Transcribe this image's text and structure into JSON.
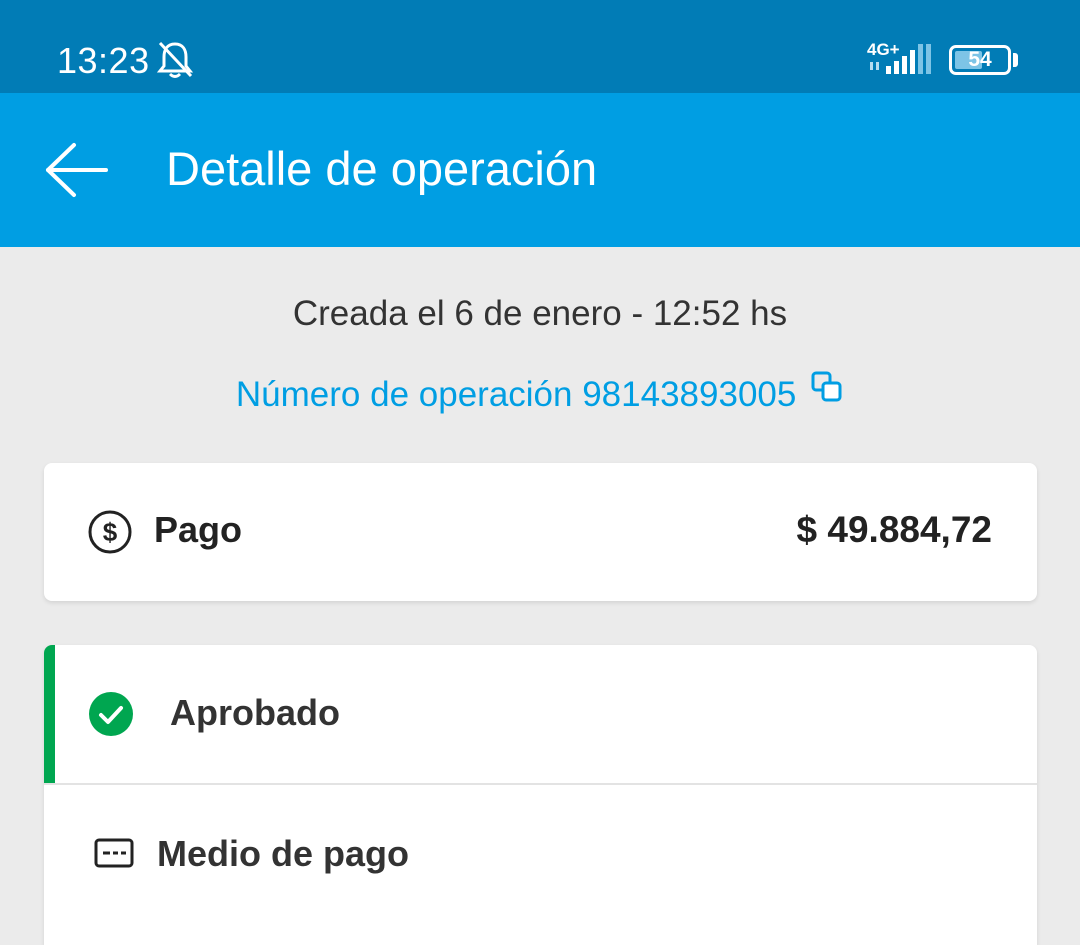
{
  "status_bar": {
    "time": "13:23",
    "network": "4G+",
    "battery": "54",
    "battery_level": 0.54,
    "icons": [
      "bell-off-icon",
      "signal-icon",
      "battery-icon"
    ]
  },
  "app_bar": {
    "back_icon": "arrow-left-icon",
    "title": "Detalle de operación"
  },
  "summary": {
    "created": "Creada el 6 de enero - 12:52 hs",
    "operation_number": "Número de operación 98143893005",
    "copy_icon": "copy-icon"
  },
  "payment": {
    "icon": "dollar-circle-icon",
    "label": "Pago",
    "amount": "$ 49.884,72"
  },
  "status": {
    "icon": "check-circle-icon",
    "label": "Aprobado",
    "color": "#00a650"
  },
  "payment_method": {
    "icon": "credit-card-icon",
    "label": "Medio de pago"
  },
  "colors": {
    "status_bar": "#017cb6",
    "app_bar": "#009ee3",
    "link": "#009ee3",
    "background": "#ebebeb"
  }
}
